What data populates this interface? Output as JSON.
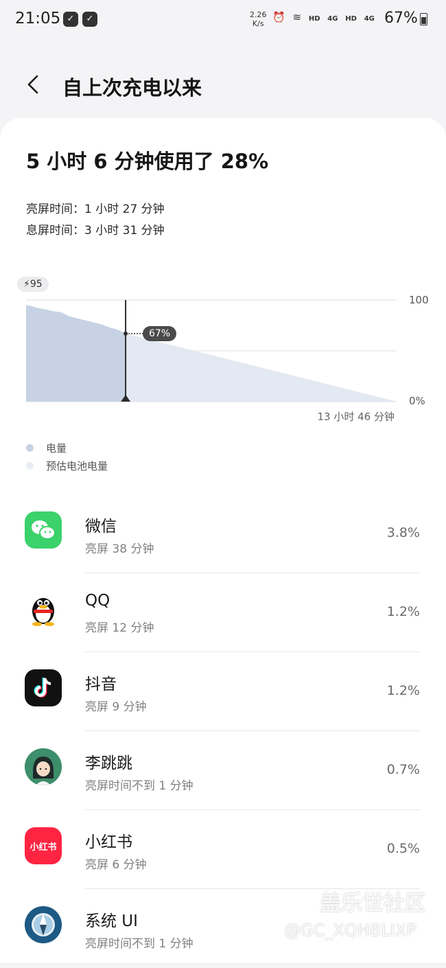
{
  "status_bar": {
    "time": "21:05",
    "speed_value": "2.26",
    "speed_unit": "K/s",
    "hd1": "HD",
    "net1": "4G",
    "hd2": "HD",
    "net2": "4G",
    "battery": "67%"
  },
  "header": {
    "title": "自上次充电以来"
  },
  "summary": {
    "headline": "5 小时 6 分钟使用了 28%",
    "screen_on": "亮屏时间：1 小时 27 分钟",
    "screen_off": "息屏时间：3 小时 31 分钟"
  },
  "chart": {
    "charge_start": "95",
    "y_max_label": "100",
    "y_min_label": "0%",
    "current_label": "67%",
    "duration_label": "13 小时 46 分钟",
    "colors": {
      "battery": "#c7d3e4",
      "estimate": "#e3e9f2",
      "marker": "#2a2a2a",
      "grid": "#dcdcdc"
    }
  },
  "chart_data": {
    "type": "area",
    "ylim": [
      0,
      100
    ],
    "series": [
      {
        "name": "电量",
        "x": [
          0,
          0.2,
          0.45,
          0.7,
          1.0,
          1.3,
          1.6,
          1.9,
          2.2,
          2.5,
          2.8,
          3.1,
          3.4,
          3.7
        ],
        "values": [
          95,
          94,
          92,
          91,
          89,
          88,
          84,
          82,
          80,
          78,
          76,
          73,
          71,
          67
        ]
      },
      {
        "name": "预估电池电量",
        "x": [
          3.7,
          13.77
        ],
        "values": [
          67,
          0
        ]
      }
    ],
    "current_value": 67,
    "x_end_label": "13 小时 46 分钟"
  },
  "legend": [
    {
      "label": "电量",
      "color": "#c7d3e4"
    },
    {
      "label": "预估电池电量",
      "color": "#e9edf3"
    }
  ],
  "apps": [
    {
      "name": "微信",
      "sub": "亮屏 38 分钟",
      "pct": "3.8%",
      "icon": "wechat-icon"
    },
    {
      "name": "QQ",
      "sub": "亮屏 12 分钟",
      "pct": "1.2%",
      "icon": "qq-icon"
    },
    {
      "name": "抖音",
      "sub": "亮屏 9 分钟",
      "pct": "1.2%",
      "icon": "douyin-icon"
    },
    {
      "name": "李跳跳",
      "sub": "亮屏时间不到 1 分钟",
      "pct": "0.7%",
      "icon": "litiaotiao-icon"
    },
    {
      "name": "小红书",
      "sub": "亮屏 6 分钟",
      "pct": "0.5%",
      "icon": "xiaohongshu-icon",
      "icon_text": "小红书"
    },
    {
      "name": "系统 UI",
      "sub": "亮屏时间不到 1 分钟",
      "pct": "",
      "icon": "system-ui-icon"
    }
  ],
  "watermark": {
    "site": "盖乐世社区",
    "user": "@GC_XQHBLIXP"
  }
}
